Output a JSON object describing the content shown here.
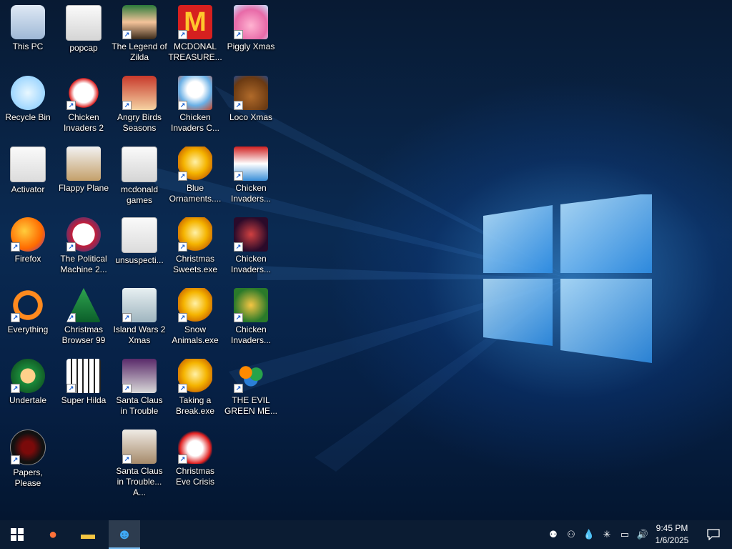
{
  "desktop": {
    "icons": [
      {
        "label": "This PC",
        "shortcut": false,
        "kind": "pc"
      },
      {
        "label": "Recycle Bin",
        "shortcut": false,
        "kind": "bin"
      },
      {
        "label": "Activator",
        "shortcut": false,
        "kind": "file"
      },
      {
        "label": "Firefox",
        "shortcut": true,
        "kind": "firefox"
      },
      {
        "label": "Everything",
        "shortcut": true,
        "kind": "search"
      },
      {
        "label": "Undertale",
        "shortcut": true,
        "kind": "circle-green"
      },
      {
        "label": "Papers, Please",
        "shortcut": true,
        "kind": "circle-black"
      },
      {
        "label": "popcap",
        "shortcut": false,
        "kind": "folder"
      },
      {
        "label": "Chicken Invaders 2",
        "shortcut": true,
        "kind": "chicken-white"
      },
      {
        "label": "Flappy Plane",
        "shortcut": false,
        "kind": "photo"
      },
      {
        "label": "The Political Machine 2...",
        "shortcut": true,
        "kind": "political"
      },
      {
        "label": "Christmas Browser 99",
        "shortcut": true,
        "kind": "tree"
      },
      {
        "label": "Super Hilda",
        "shortcut": true,
        "kind": "pixel"
      },
      {
        "label": "The Legend of Zilda",
        "shortcut": true,
        "kind": "char"
      },
      {
        "label": "Angry Birds Seasons",
        "shortcut": true,
        "kind": "angry"
      },
      {
        "label": "mcdonald games",
        "shortcut": false,
        "kind": "folder"
      },
      {
        "label": "unsuspecti...",
        "shortcut": false,
        "kind": "file"
      },
      {
        "label": "Island Wars 2 Xmas",
        "shortcut": true,
        "kind": "island"
      },
      {
        "label": "Santa Claus in Trouble",
        "shortcut": true,
        "kind": "santa"
      },
      {
        "label": "Santa Claus in Trouble... A...",
        "shortcut": true,
        "kind": "santa2"
      },
      {
        "label": "MCDONAL TREASURE...",
        "shortcut": true,
        "kind": "mcd"
      },
      {
        "label": "Chicken Invaders C...",
        "shortcut": true,
        "kind": "snowman"
      },
      {
        "label": "Blue Ornaments....",
        "shortcut": true,
        "kind": "burst"
      },
      {
        "label": "Christmas Sweets.exe",
        "shortcut": true,
        "kind": "burst"
      },
      {
        "label": "Snow Animals.exe",
        "shortcut": true,
        "kind": "burst"
      },
      {
        "label": "Taking a Break.exe",
        "shortcut": true,
        "kind": "burst"
      },
      {
        "label": "Christmas Eve Crisis",
        "shortcut": true,
        "kind": "santa-face"
      },
      {
        "label": "Piggly Xmas",
        "shortcut": true,
        "kind": "pig"
      },
      {
        "label": "Loco Xmas",
        "shortcut": true,
        "kind": "bear"
      },
      {
        "label": "Chicken Invaders...",
        "shortcut": true,
        "kind": "chicken-xmas"
      },
      {
        "label": "Chicken Invaders...",
        "shortcut": true,
        "kind": "chicken-space"
      },
      {
        "label": "Chicken Invaders...",
        "shortcut": true,
        "kind": "chicken-green"
      },
      {
        "label": "THE EVIL GREEN ME...",
        "shortcut": true,
        "kind": "messenger"
      }
    ]
  },
  "taskbar": {
    "start_icon": "windows-logo",
    "pinned": [
      {
        "name": "firefox",
        "glyph": "●",
        "color": "#ff7139",
        "active": false
      },
      {
        "name": "file-explorer",
        "glyph": "▬",
        "color": "#f4c542",
        "active": false
      },
      {
        "name": "messenger",
        "glyph": "☻",
        "color": "#3fa9f5",
        "active": true
      }
    ],
    "tray": [
      "⚉",
      "⚇",
      "💧",
      "✳",
      "▭",
      "🔊"
    ],
    "time": "9:45 PM",
    "date": "1/6/2025",
    "notifications_icon": "speech-bubble-icon"
  }
}
